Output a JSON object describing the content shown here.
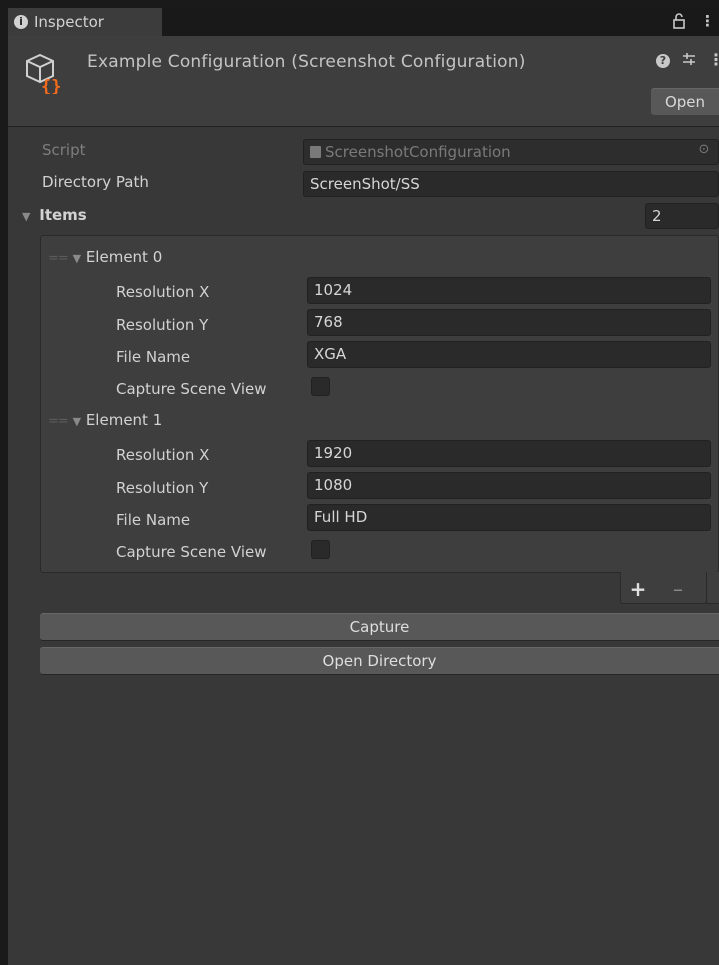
{
  "tab": {
    "label": "Inspector",
    "icon": "info-icon"
  },
  "header": {
    "title": "Example Configuration (Screenshot Configuration)",
    "asset_icon": "scriptable-object-icon",
    "open_label": "Open"
  },
  "fields": {
    "script_label": "Script",
    "script_value": "ScreenshotConfiguration",
    "directory_label": "Directory Path",
    "directory_value": "ScreenShot/SS",
    "items_label": "Items",
    "items_count": "2"
  },
  "elements": [
    {
      "title": "Element 0",
      "resolution_x_label": "Resolution X",
      "resolution_x": "1024",
      "resolution_y_label": "Resolution Y",
      "resolution_y": "768",
      "file_name_label": "File Name",
      "file_name": "XGA",
      "capture_label": "Capture Scene View",
      "capture_checked": false
    },
    {
      "title": "Element 1",
      "resolution_x_label": "Resolution X",
      "resolution_x": "1920",
      "resolution_y_label": "Resolution Y",
      "resolution_y": "1080",
      "file_name_label": "File Name",
      "file_name": "Full HD",
      "capture_label": "Capture Scene View",
      "capture_checked": false
    }
  ],
  "list_footer": {
    "add": "+",
    "remove": "–"
  },
  "buttons": {
    "capture": "Capture",
    "open_directory": "Open Directory"
  },
  "colors": {
    "background": "#383838",
    "field": "#2a2a2a",
    "button": "#585858",
    "asset_icon_accent": "#f26b1d"
  }
}
